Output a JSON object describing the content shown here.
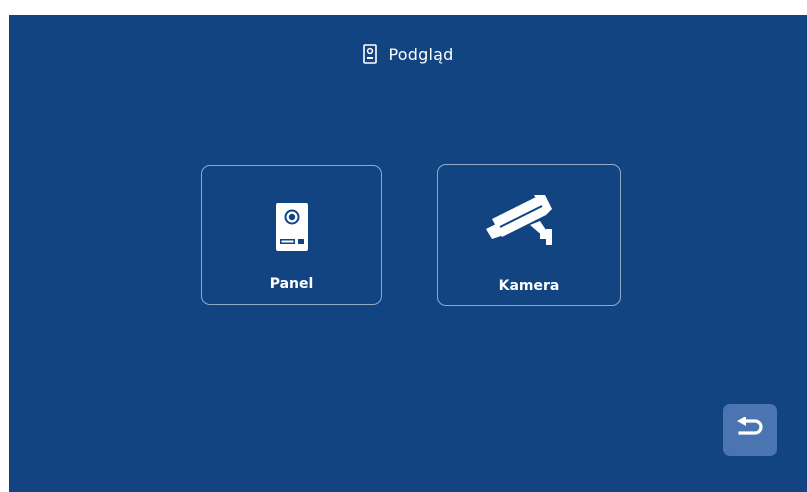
{
  "header": {
    "icon": "door-panel-icon",
    "title": "Podgląd"
  },
  "tiles": [
    {
      "icon": "door-panel-icon",
      "label": "Panel"
    },
    {
      "icon": "cctv-camera-icon",
      "label": "Kamera"
    }
  ],
  "back_button": {
    "icon": "return-arrow-icon"
  },
  "colors": {
    "background": "#114480",
    "tile_border": "#8aa2c2",
    "back_button": "#4a75b1",
    "text": "#ffffff"
  }
}
